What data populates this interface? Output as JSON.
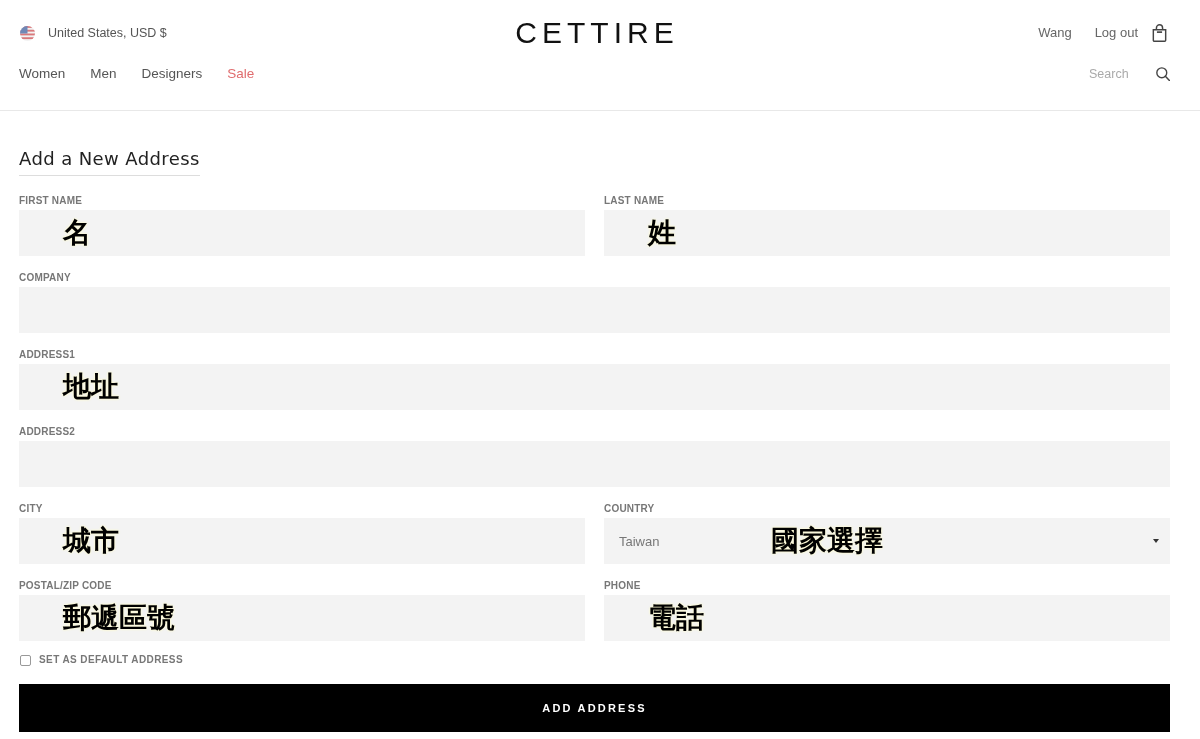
{
  "header": {
    "locale": {
      "label": "United States, USD $"
    },
    "logo": "CETTIRE",
    "account": {
      "user": "Wang",
      "logout": "Log out"
    },
    "nav": [
      {
        "label": "Women",
        "kind": "regular"
      },
      {
        "label": "Men",
        "kind": "regular"
      },
      {
        "label": "Designers",
        "kind": "regular"
      },
      {
        "label": "Sale",
        "kind": "sale"
      }
    ],
    "search": {
      "placeholder": "Search"
    }
  },
  "form": {
    "title": "Add a New Address",
    "rows": [
      {
        "fields": [
          {
            "label": "FIRST NAME",
            "kind": "text",
            "annotation": "名"
          },
          {
            "label": "LAST NAME",
            "kind": "text",
            "annotation": "姓"
          }
        ]
      },
      {
        "fields": [
          {
            "label": "COMPANY",
            "kind": "text"
          }
        ]
      },
      {
        "fields": [
          {
            "label": "ADDRESS1",
            "kind": "text",
            "annotation": "地址"
          }
        ]
      },
      {
        "fields": [
          {
            "label": "ADDRESS2",
            "kind": "text"
          }
        ]
      },
      {
        "fields": [
          {
            "label": "CITY",
            "kind": "text",
            "annotation": "城市"
          },
          {
            "label": "COUNTRY",
            "kind": "select",
            "value": "Taiwan",
            "annotation": "國家選擇"
          }
        ]
      },
      {
        "fields": [
          {
            "label": "POSTAL/ZIP CODE",
            "kind": "text",
            "annotation": "郵遞區號"
          },
          {
            "label": "PHONE",
            "kind": "text",
            "annotation": "電話"
          }
        ]
      }
    ],
    "default_checkbox": {
      "label": "SET AS DEFAULT ADDRESS",
      "checked": false
    },
    "submit": "ADD ADDRESS"
  }
}
